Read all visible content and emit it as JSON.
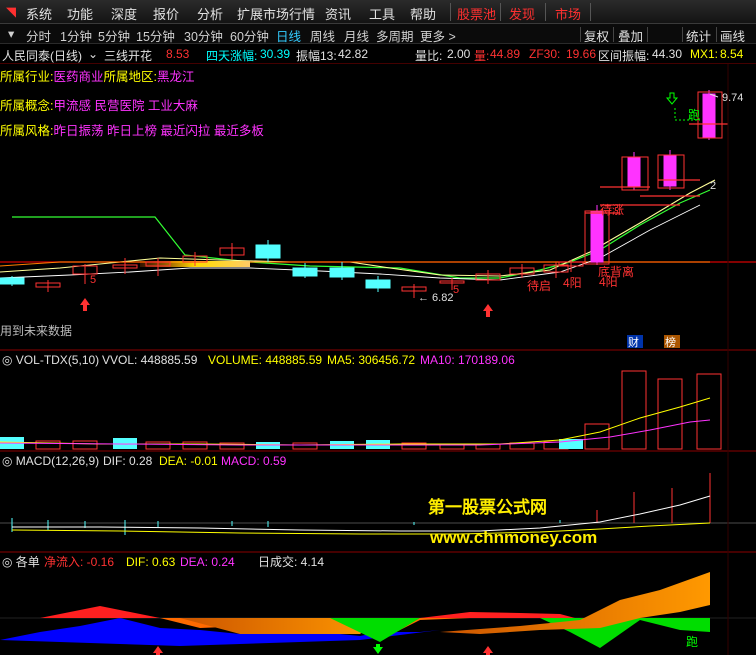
{
  "menu": [
    {
      "label": "系统",
      "hot": false
    },
    {
      "label": "功能",
      "hot": false
    },
    {
      "label": "深度",
      "hot": false
    },
    {
      "label": "报价",
      "hot": false
    },
    {
      "label": "分析",
      "hot": false
    },
    {
      "label": "扩展市场行情",
      "hot": false
    },
    {
      "label": "资讯",
      "hot": false
    },
    {
      "label": "工具",
      "hot": false
    },
    {
      "label": "帮助",
      "hot": false
    },
    {
      "label": "股票池",
      "hot": true
    },
    {
      "label": "发现",
      "hot": true
    },
    {
      "label": "市场",
      "hot": true
    }
  ],
  "timeframes": [
    {
      "label": "分时",
      "active": false
    },
    {
      "label": "1分钟",
      "active": false
    },
    {
      "label": "5分钟",
      "active": false
    },
    {
      "label": "15分钟",
      "active": false
    },
    {
      "label": "30分钟",
      "active": false
    },
    {
      "label": "60分钟",
      "active": false
    },
    {
      "label": "日线",
      "active": true
    },
    {
      "label": "周线",
      "active": false
    },
    {
      "label": "月线",
      "active": false
    },
    {
      "label": "多周期",
      "active": false
    },
    {
      "label": "更多 >",
      "active": false
    }
  ],
  "tools": [
    "复权",
    "叠加",
    "统计",
    "画线"
  ],
  "info": {
    "stock_name": "人民同泰(日线)",
    "indicator": "三线开花",
    "indicator_value": "8.53",
    "rise4_label": "四天涨幅:",
    "rise4_value": "30.39",
    "amp13_label": "振幅13:",
    "amp13_value": "42.82",
    "liangbi_label": "量比:",
    "liangbi_value": "2.00",
    "liang_label": "量:",
    "liang_value": "44.89",
    "zf30_label": "ZF30:",
    "zf30_value": "19.66",
    "range_label": "区间振幅:",
    "range_value": "44.30",
    "mx_label": "MX1:",
    "mx_value": "8.54"
  },
  "overlay": {
    "industry_prefix": "所属行业:",
    "industry_value": "医药商业",
    "region_prefix": "所属地区:",
    "region_value": "黑龙江",
    "concept_prefix": "所属概念:",
    "concept_value": "甲流感 民营医院 工业大麻",
    "style_prefix": "所属风格:",
    "style_value": "昨日振荡 昨日上榜 最近闪拉 最近多板",
    "future_data": "用到未来数据",
    "cai": "财",
    "bang": "榜"
  },
  "chart_data": [
    {
      "type": "candlestick",
      "panel": "main",
      "annotations": {
        "high_price": "9.74",
        "low_price": "6.82",
        "run_tag": "跑",
        "count_tag": "2",
        "tags": [
          "待涨",
          "底背离",
          "待启",
          "4阳",
          "4阳",
          "5",
          "5"
        ]
      }
    },
    {
      "type": "bar",
      "panel": "volume",
      "title": "VOL-TDX(5,10)",
      "vvol_label": "VVOL:",
      "vvol_value": "448885.59",
      "volume_label": "VOLUME:",
      "volume_value": "448885.59",
      "ma5_label": "MA5:",
      "ma5_value": "306456.72",
      "ma10_label": "MA10:",
      "ma10_value": "170189.06"
    },
    {
      "type": "line",
      "panel": "macd",
      "title": "MACD(12,26,9)",
      "dif_label": "DIF:",
      "dif_value": "0.28",
      "dea_label": "DEA:",
      "dea_value": "-0.01",
      "macd_label": "MACD:",
      "macd_value": "0.59"
    },
    {
      "type": "area",
      "panel": "flow",
      "title": "各单",
      "flow_label": "净流入:",
      "flow_value": "-0.16",
      "dif_label": "DIF:",
      "dif_value": "0.63",
      "dea_label": "DEA:",
      "dea_value": "0.24",
      "turnover_label": "日成交:",
      "turnover_value": "4.14",
      "run_tag": "跑"
    }
  ],
  "watermark": {
    "line1": "第一股票公式网",
    "line2": "www.chnmoney.com"
  },
  "colors": {
    "up": "#ff3232",
    "down": "#54ffff",
    "magenta": "#ff33ff",
    "yellow": "#ffff00",
    "green": "#00ff00"
  }
}
